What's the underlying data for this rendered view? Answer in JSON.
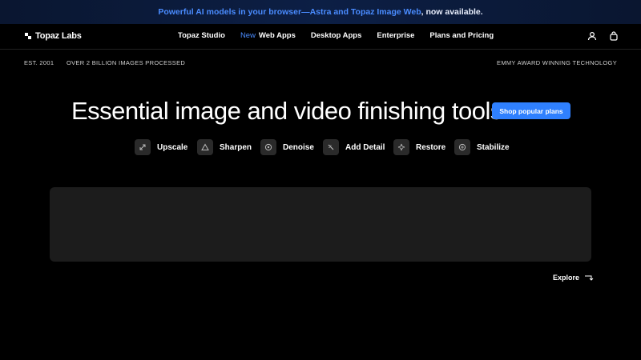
{
  "banner": {
    "link_text": "Powerful AI models in your browser—Astra and Topaz Image Web",
    "rest_text": ", now available."
  },
  "nav": {
    "logo_text": "Topaz Labs",
    "items": [
      {
        "label": "Topaz Studio"
      },
      {
        "label": "Web Apps",
        "badge": "New"
      },
      {
        "label": "Desktop Apps"
      },
      {
        "label": "Enterprise"
      },
      {
        "label": "Plans and Pricing"
      }
    ],
    "icons": [
      "user-icon",
      "shopping-bag-icon"
    ]
  },
  "meta": {
    "established": "EST. 2001",
    "images_processed": "OVER 2 BILLION IMAGES PROCESSED",
    "award": "EMMY AWARD WINNING TECHNOLOGY"
  },
  "hero": {
    "headline": "Essential image and video finishing tools.",
    "cta_label": "Shop popular plans"
  },
  "features": [
    {
      "label": "Upscale",
      "icon": "expand-arrows-icon"
    },
    {
      "label": "Sharpen",
      "icon": "triangle-icon"
    },
    {
      "label": "Denoise",
      "icon": "circle-dot-icon"
    },
    {
      "label": "Add Detail",
      "icon": "magic-wand-icon"
    },
    {
      "label": "Restore",
      "icon": "sparkle-icon"
    },
    {
      "label": "Stabilize",
      "icon": "stabilize-icon"
    }
  ],
  "explore": {
    "label": "Explore"
  },
  "colors": {
    "accent": "#2f80ff",
    "link_blue": "#4a8cff",
    "background": "#000000",
    "tile": "#1c1c1c"
  }
}
